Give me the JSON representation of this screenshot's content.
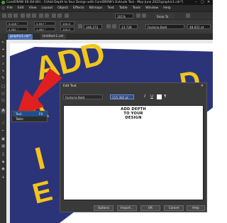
{
  "window": {
    "title": "CorelDRAW X8 (64-Bit) - [\\\\Add Depth to Your Design with CorelDRAW's Extrude Tool - May-June 2022\\graphic1.cdr*]",
    "controls": [
      "–",
      "▢",
      "✕"
    ]
  },
  "menu": {
    "items": [
      "File",
      "Edit",
      "View",
      "Layout",
      "Object",
      "Effects",
      "Bitmaps",
      "Text",
      "Table",
      "Tools",
      "Window",
      "Help"
    ]
  },
  "toolbar": {
    "zoom": "101%",
    "snap_label": "Snap To"
  },
  "property_bar": {
    "x": "5.418 \"",
    "y": "4.281 \"",
    "w": "5.557 \"",
    "h": "1.492 \"",
    "scale_w": "100.0",
    "scale_h": "100.0",
    "angle": "346.272",
    "angle2": "13.728",
    "font": "Factoria Bold",
    "size": "48.652 pt"
  },
  "doc_tabs": [
    "graphic1.cdr*",
    "Untitled-1.cdr"
  ],
  "flyout": {
    "items": [
      "Text",
      "Table"
    ],
    "shortcut": "F8"
  },
  "dialog": {
    "title": "Edit Text",
    "font": "Factoria Bold",
    "size": "115.302 pt",
    "text_lines": [
      "ADD DEPTH",
      "TO YOUR",
      "DESIGN"
    ],
    "buttons": {
      "options": "Options",
      "import": "Import...",
      "ok": "OK",
      "cancel": "Cancel",
      "help": "Help"
    }
  },
  "colors": {
    "artwork_navy": "#2c3479",
    "artwork_yellow": "#f2c51a",
    "arrow_red": "#e02020"
  }
}
